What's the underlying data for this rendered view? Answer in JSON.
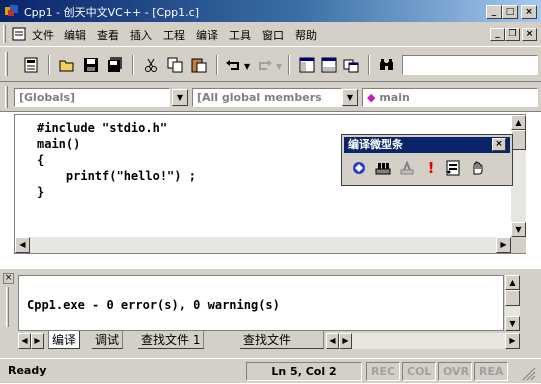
{
  "window": {
    "title": "Cpp1 - 创天中文VC++ - [Cpp1.c]"
  },
  "menubar": {
    "items": [
      "文件",
      "编辑",
      "查看",
      "插入",
      "工程",
      "编译",
      "工具",
      "窗口",
      "帮助"
    ]
  },
  "toolbar2": {
    "scope_value": "[Globals]",
    "members_value": "[All global members",
    "function_value": "main"
  },
  "editor": {
    "lines": [
      "#include \"stdio.h\"",
      "main()",
      "{",
      "    printf(\"hello!\") ;",
      "}"
    ]
  },
  "build_toolbar": {
    "title": "编译微型条"
  },
  "output": {
    "line": "Cpp1.exe - 0 error(s), 0 warning(s)",
    "tabs": [
      "编译",
      "调试",
      "查找文件 1",
      "查找文件"
    ]
  },
  "statusbar": {
    "status": "Ready",
    "position": "Ln 5, Col 2",
    "indicators": [
      "REC",
      "COL",
      "OVR",
      "REA"
    ]
  },
  "icons": [
    "app-icon",
    "workspace-icon",
    "open-icon",
    "save-icon",
    "save-all-icon",
    "cut-icon",
    "copy-icon",
    "paste-icon",
    "undo-icon",
    "redo-icon",
    "workspace-pane-icon",
    "output-pane-icon",
    "windows-icon",
    "find-icon",
    "compile-icon",
    "build-icon",
    "stop-build-icon",
    "execute-icon",
    "breakpoint-icon",
    "go-icon"
  ]
}
